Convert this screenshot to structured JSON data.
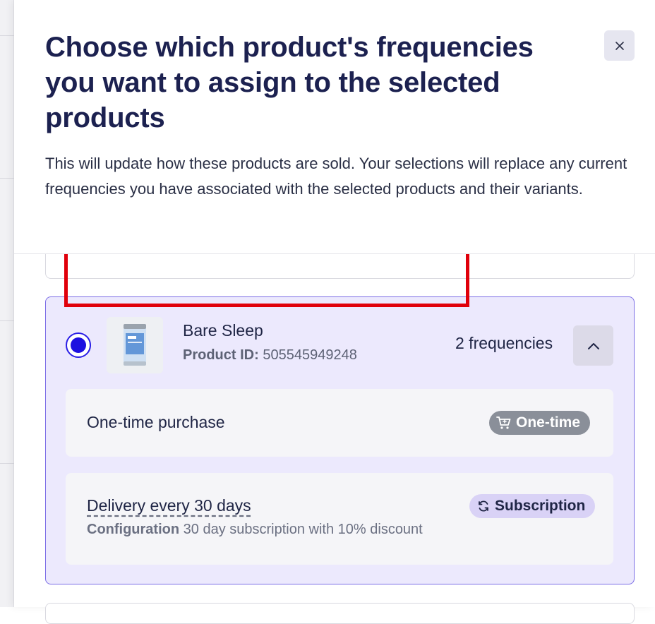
{
  "modal": {
    "title": "Choose which product's frequencies you want to assign to the selected products",
    "description": "This will update how these products are sold. Your selections will replace any current frequencies you have associated with the selected products and their variants.",
    "close_label": "×"
  },
  "product": {
    "name": "Bare Sleep",
    "id_label": "Product ID:",
    "id_value": "505545949248",
    "frequency_count": "2 frequencies",
    "selected": true,
    "thumbnail_icon": "product-canister-icon"
  },
  "frequencies": [
    {
      "label": "One-time purchase",
      "badge": "One-time",
      "badge_icon": "cart-icon",
      "badge_color": "#8a8f99"
    },
    {
      "label": "Delivery every 30 days",
      "config_label": "Configuration",
      "config_value": "30 day subscription with 10% discount",
      "badge": "Subscription",
      "badge_icon": "refresh-icon",
      "badge_color": "#d9d2f6"
    }
  ],
  "colors": {
    "accent": "#1d10e0",
    "card_bg": "#ece9fd",
    "highlight": "#e0000b",
    "title": "#1c2150"
  }
}
